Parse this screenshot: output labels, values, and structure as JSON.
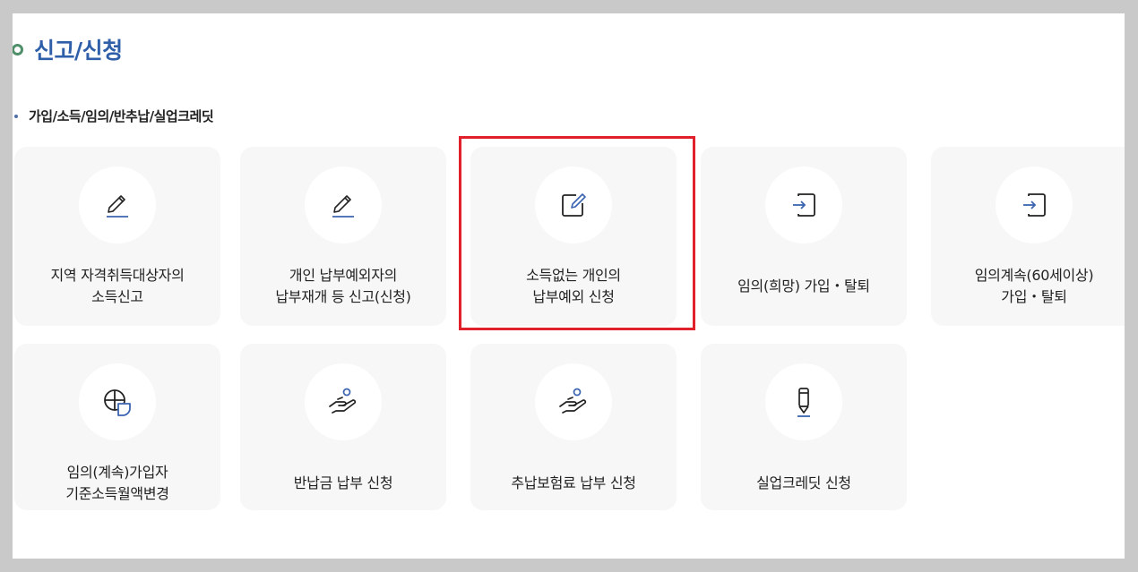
{
  "section": {
    "title": "신고/신청"
  },
  "subsection": {
    "title": "가입/소득/임의/반추납/실업크레딧"
  },
  "cards": [
    {
      "label": "지역 자격취득대상자의\n소득신고",
      "icon": "pencil-underline-icon"
    },
    {
      "label": "개인 납부예외자의\n납부재개 등 신고(신청)",
      "icon": "pencil-underline-icon"
    },
    {
      "label": "소득없는 개인의\n납부예외 신청",
      "icon": "edit-square-icon"
    },
    {
      "label": "임의(희망) 가입・탈퇴",
      "icon": "sign-in-icon"
    },
    {
      "label": "임의계속(60세이상)\n가입・탈퇴",
      "icon": "sign-in-icon"
    },
    {
      "label": "임의(계속)가입자\n기준소득월액변경",
      "icon": "pie-chart-icon"
    },
    {
      "label": "반납금 납부 신청",
      "icon": "hand-person-icon"
    },
    {
      "label": "추납보험료 납부 신청",
      "icon": "hand-person-icon"
    },
    {
      "label": "실업크레딧 신청",
      "icon": "pen-icon"
    }
  ],
  "colors": {
    "accent": "#2f5fa8",
    "icon_stroke": "#222222",
    "icon_accent": "#3b64b0",
    "highlight": "#e0202a"
  }
}
